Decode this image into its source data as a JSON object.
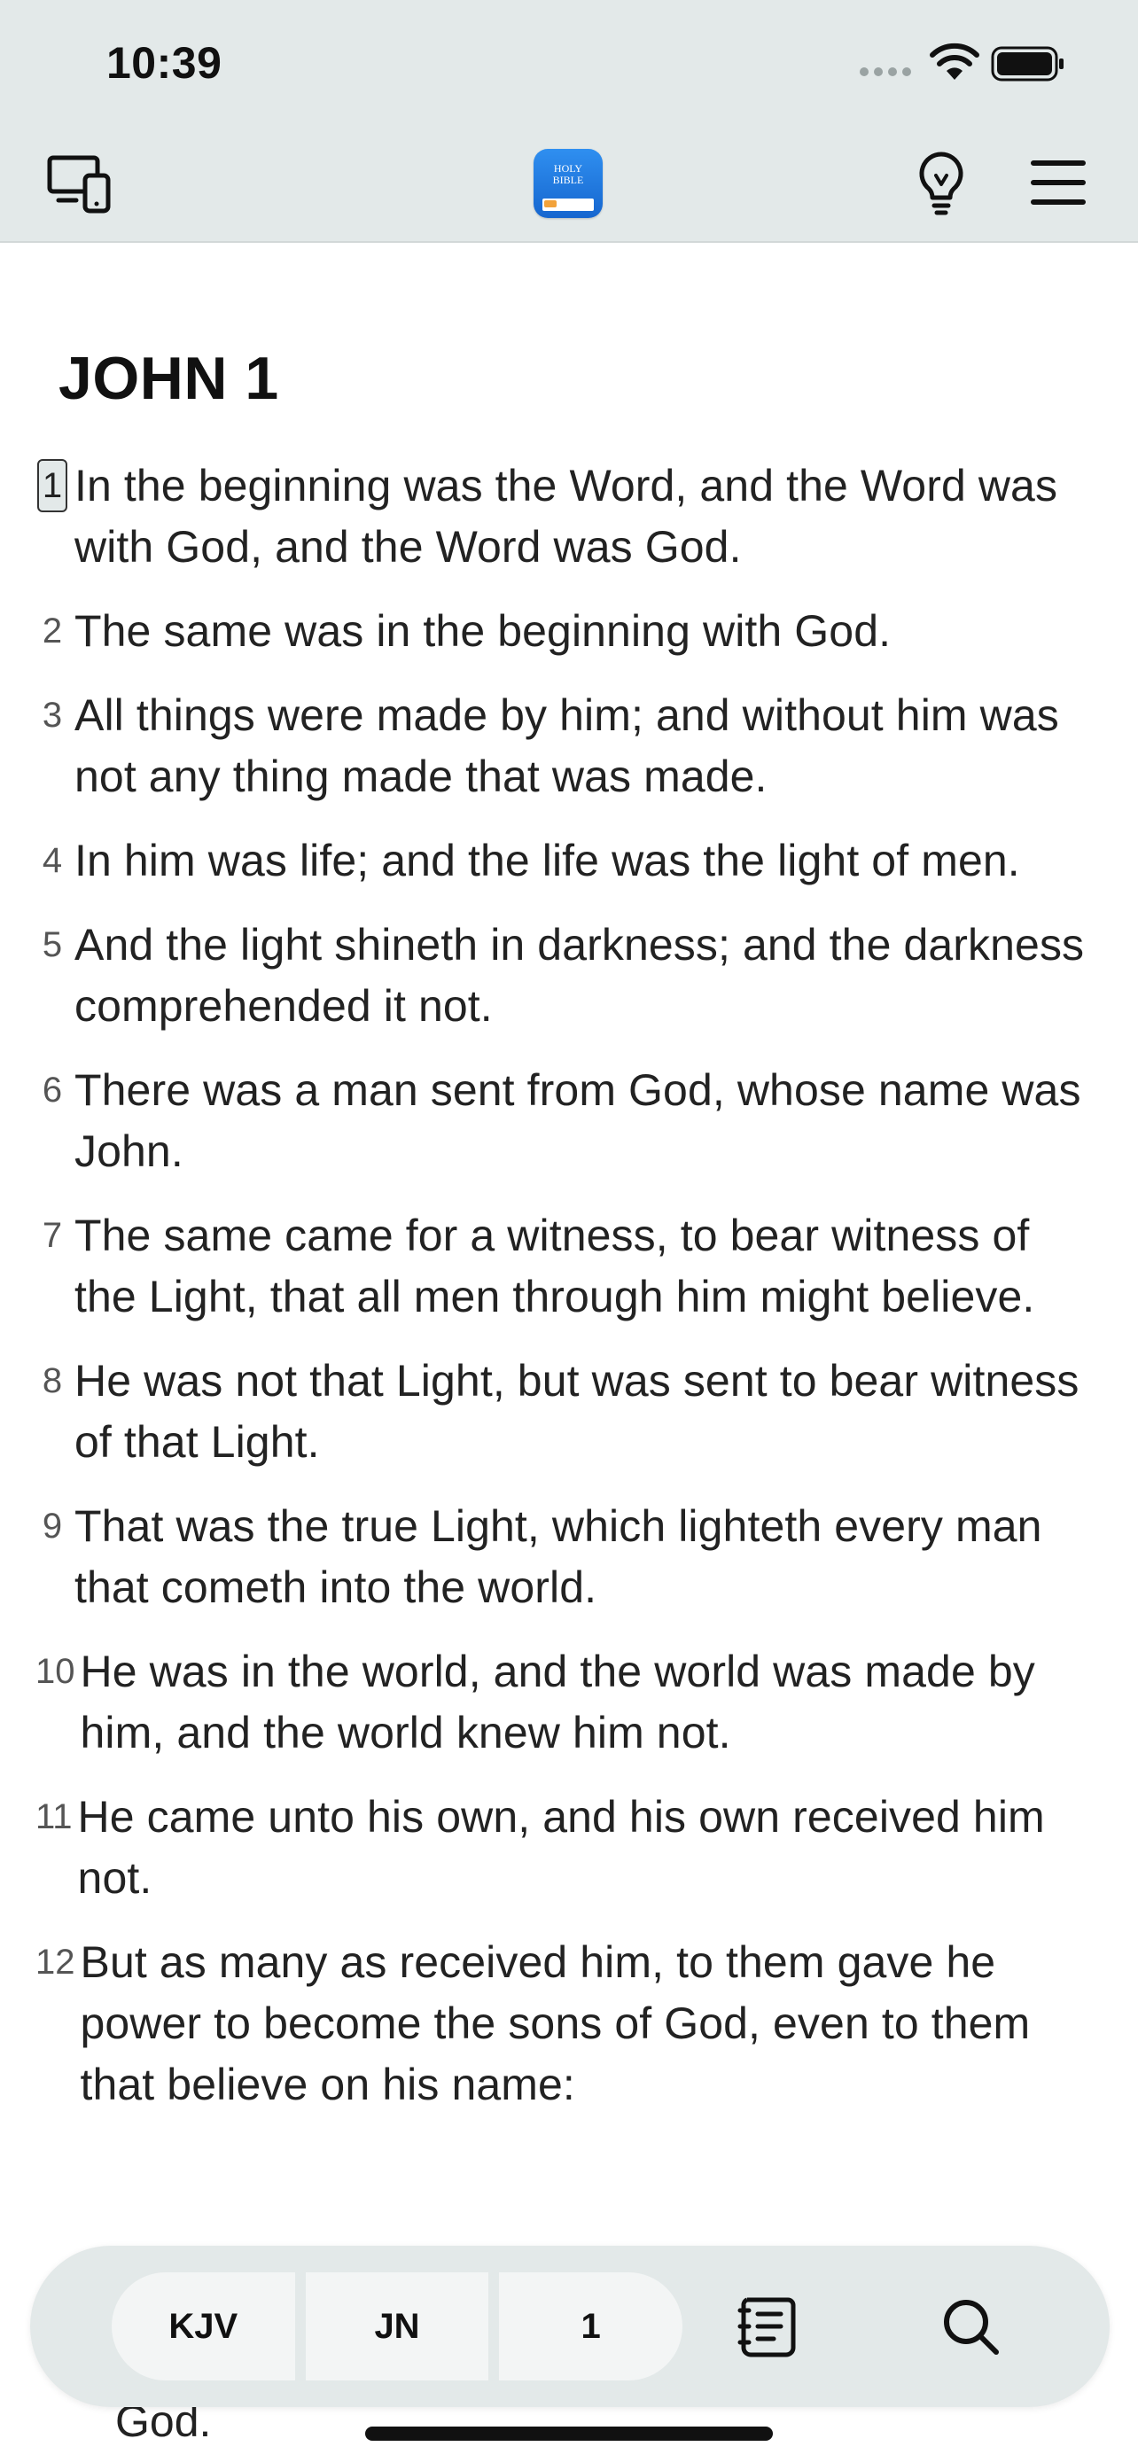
{
  "status": {
    "time": "10:39"
  },
  "app_logo": {
    "line1": "HOLY",
    "line2": "BIBLE"
  },
  "chapter": {
    "title": "JOHN 1"
  },
  "verses": [
    {
      "num": "1",
      "text": "In the beginning was the Word, and the Word was with God, and the Word was God."
    },
    {
      "num": "2",
      "text": "The same was in the beginning with God."
    },
    {
      "num": "3",
      "text": "All things were made by him; and without him was not any thing made that was made."
    },
    {
      "num": "4",
      "text": "In him was life; and the life was the light of men."
    },
    {
      "num": "5",
      "text": "And the light shineth in darkness; and the darkness comprehended it not."
    },
    {
      "num": "6",
      "text": "There was a man sent from God, whose name was John."
    },
    {
      "num": "7",
      "text": "The same came for a witness, to bear witness of the Light, that all men through him might believe."
    },
    {
      "num": "8",
      "text": "He was not that Light, but was sent to bear witness of that Light."
    },
    {
      "num": "9",
      "text": "That was the true Light, which lighteth every man that cometh into the world."
    },
    {
      "num": "10",
      "text": "He was in the world, and the world was made by him, and the world knew him not."
    },
    {
      "num": "11",
      "text": "He came unto his own, and his own received him not."
    },
    {
      "num": "12",
      "text": "But as many as received him, to them gave he power to become the sons of God, even to them that believe on his name:"
    }
  ],
  "peek_text": "God.",
  "bottom_bar": {
    "version": "KJV",
    "book": "JN",
    "chapter": "1"
  },
  "icons": {
    "device": "devices-icon",
    "idea": "lightbulb-icon",
    "menu": "hamburger-menu-icon",
    "notes": "notes-icon",
    "search": "search-icon"
  },
  "colors": {
    "bar_bg": "#e3e9e9",
    "text": "#222222"
  }
}
